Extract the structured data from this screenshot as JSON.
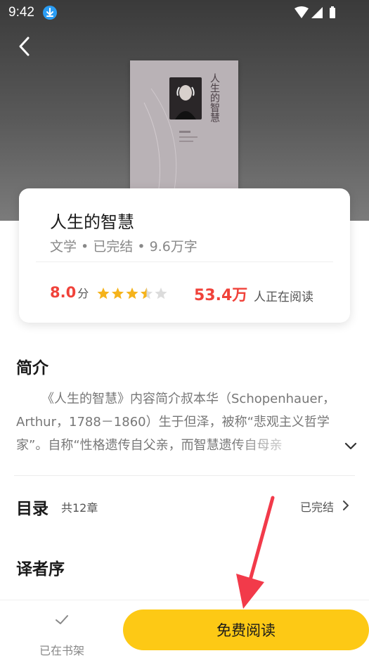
{
  "status_bar": {
    "time": "9:42",
    "icons": [
      "download-icon",
      "wifi-icon",
      "signal-icon",
      "battery-icon"
    ]
  },
  "cover": {
    "title": "人生的智慧"
  },
  "book": {
    "title": "人生的智慧",
    "meta": "文学 • 已完结 • 9.6万字",
    "score": "8.0",
    "score_unit": "分",
    "rating_stars": 3.5,
    "rating_max": 5,
    "readers": "53.4万",
    "readers_label": "人正在阅读"
  },
  "intro": {
    "title": "简介",
    "text": "《人生的智慧》内容简介叔本华（Schopenhauer，Arthur，1788－1860）生于但泽，被称“悲观主义哲学家”。自称“性格遗传自父亲，而智慧遗传自母亲"
  },
  "toc": {
    "title": "目录",
    "count": "共12章",
    "status": "已完结"
  },
  "preface": {
    "title": "译者序"
  },
  "bottom_bar": {
    "shelf_label": "已在书架",
    "read_label": "免费阅读"
  },
  "colors": {
    "accent_red": "#f0423a",
    "button_yellow": "#fdc915",
    "star_yellow": "#f5b31b",
    "arrow_red": "#f23a4a"
  }
}
